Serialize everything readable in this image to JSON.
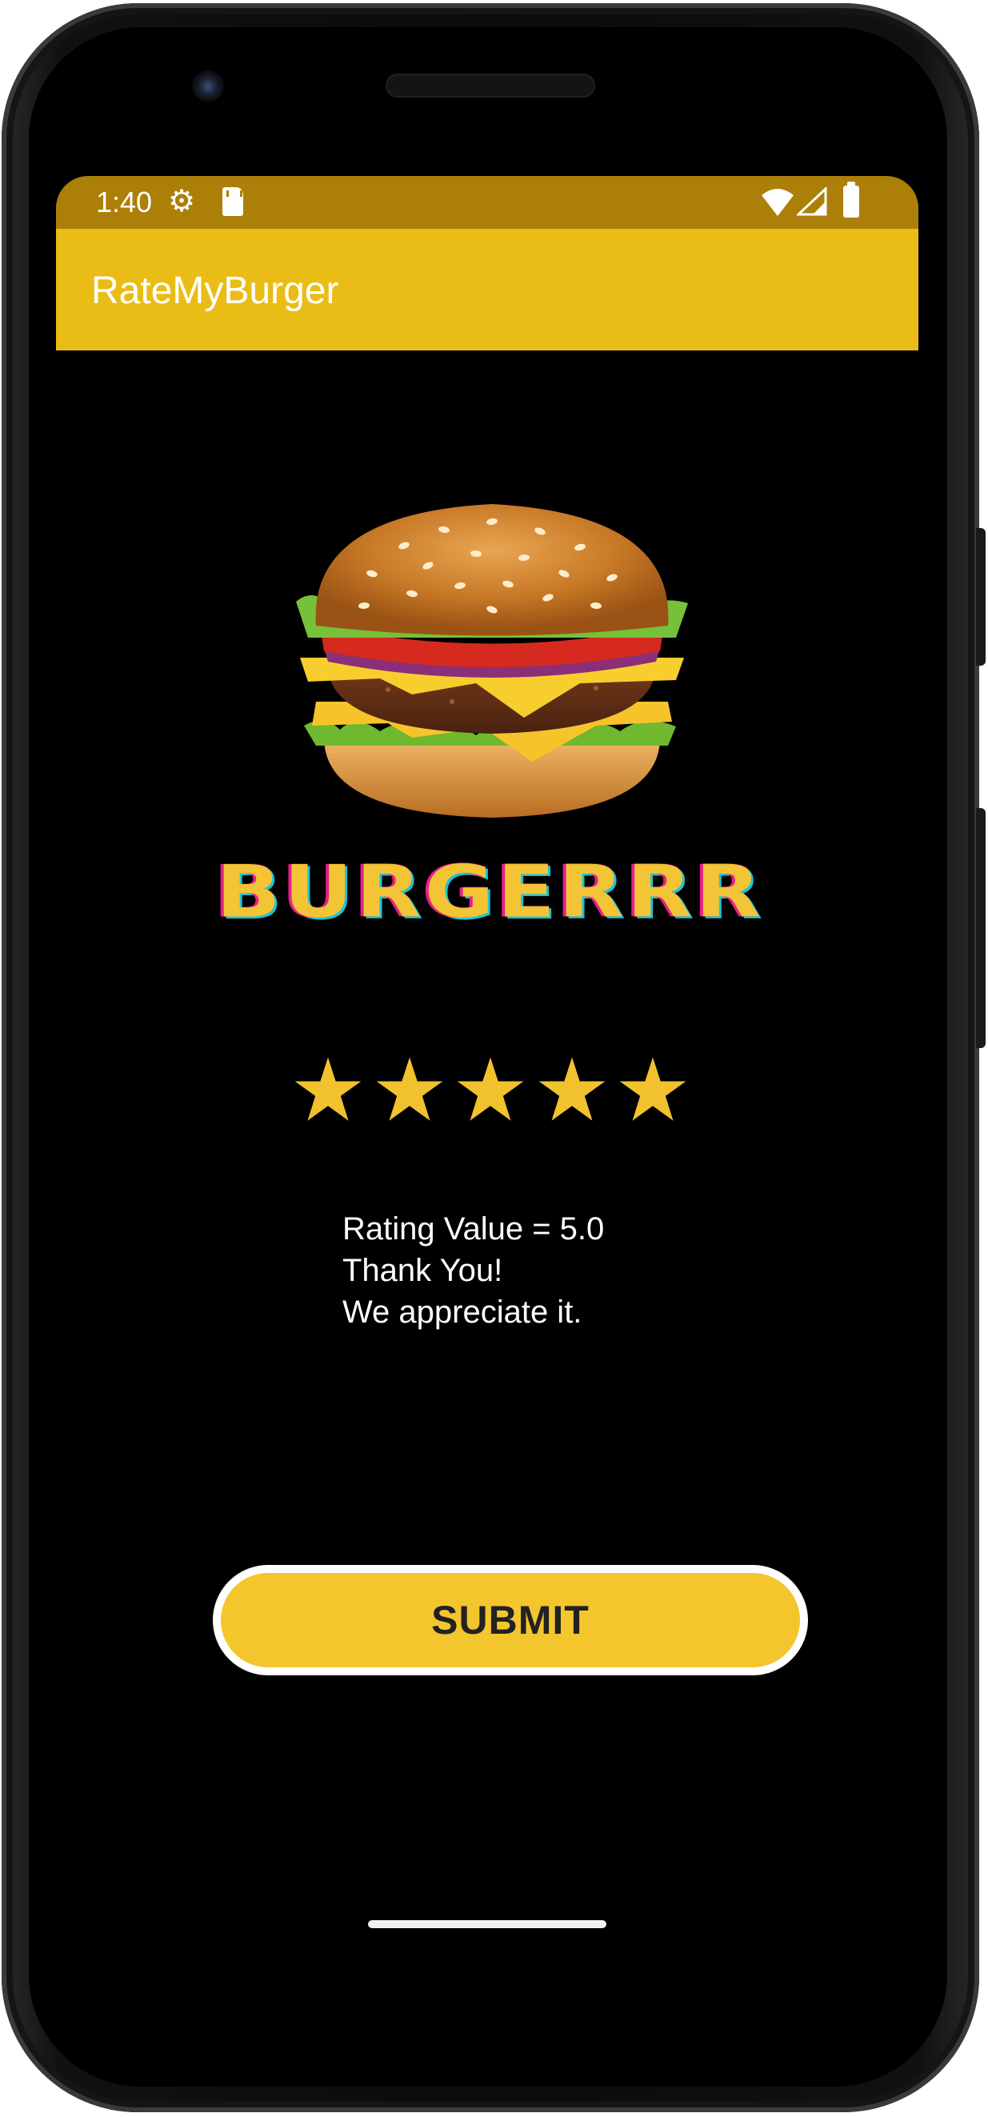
{
  "status_bar": {
    "time": "1:40",
    "icons": [
      "settings-gear-icon",
      "sd-card-icon",
      "wifi-icon",
      "cell-signal-icon",
      "battery-icon"
    ]
  },
  "app_bar": {
    "title": "RateMyBurger",
    "color": "#e9bd15"
  },
  "hero": {
    "image": "burger-image",
    "logo_text": "BURGERRR"
  },
  "rating": {
    "stars_filled": 5,
    "stars_total": 5,
    "star_color": "#f2c12e",
    "lines": [
      "Rating Value = 5.0",
      "Thank You!",
      "We appreciate it."
    ]
  },
  "submit_button": {
    "label": "SUBMIT",
    "color": "#f3c62e"
  }
}
